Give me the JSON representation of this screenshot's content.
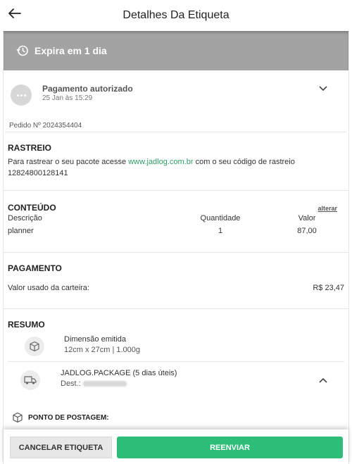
{
  "header": {
    "title": "Detalhes Da Etiqueta"
  },
  "expire": {
    "text": "Expira em 1 dia"
  },
  "payment_status": {
    "title": "Pagamento autorizado",
    "date": "25 Jan às 15:29"
  },
  "order": {
    "text": "Pedido Nº 2024354404"
  },
  "rastreio": {
    "title": "RASTREIO",
    "text_before": "Para rastrear o seu pacote acesse ",
    "link": "www.jadlog.com.br",
    "text_after": " com o seu código de rastreio 12824800128141"
  },
  "conteudo": {
    "title": "CONTEÚDO",
    "alter_label": "alterar",
    "headers": [
      "Descrição",
      "Quantidade",
      "Valor"
    ],
    "rows": [
      [
        "planner",
        "1",
        "87,00"
      ]
    ]
  },
  "pagamento": {
    "title": "PAGAMENTO",
    "label": "Valor usado da carteira:",
    "value": "R$ 23,47"
  },
  "resumo": {
    "title": "RESUMO",
    "dimension_title": "Dimensão emitida",
    "dimension_value": "12cm x 27cm | 1.000g",
    "shipping_title": "JADLOG.PACKAGE (5 dias úteis)",
    "dest_label": "Dest.:"
  },
  "posting": {
    "title": "PONTO DE POSTAGEM:"
  },
  "footer": {
    "cancel_label": "CANCELAR ETIQUETA",
    "resend_label": "REENVIAR"
  },
  "colors": {
    "accent": "#2dbd78",
    "link": "#2e9d63",
    "banner": "#a3a3a3"
  },
  "icons": [
    "back-arrow-icon",
    "history-clock-icon",
    "more-dots-icon",
    "chevron-down-icon",
    "box-icon",
    "truck-icon",
    "chevron-up-icon"
  ]
}
